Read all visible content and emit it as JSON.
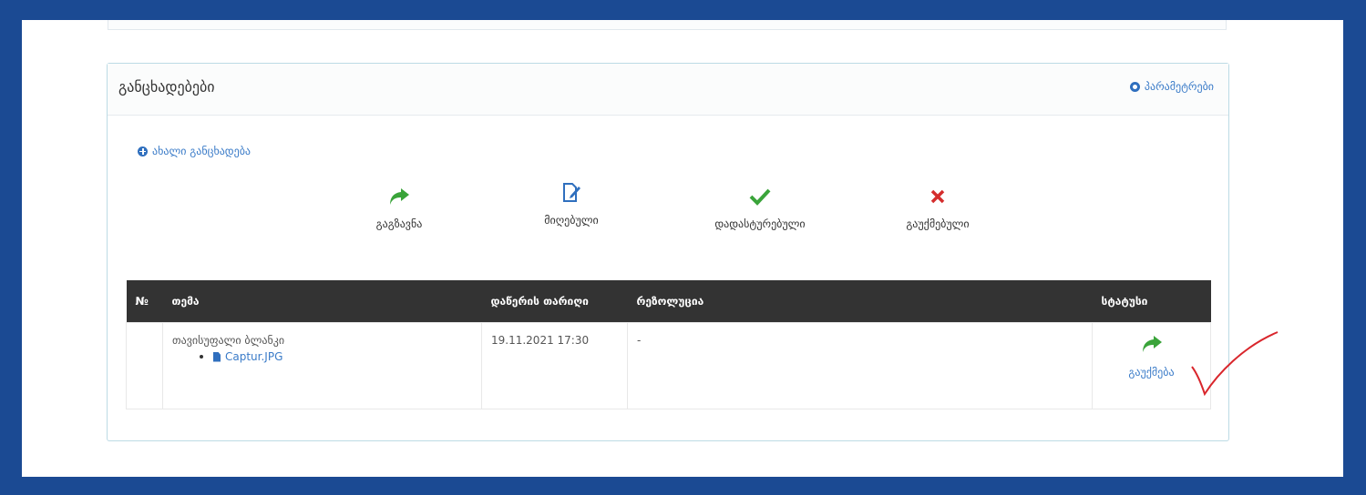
{
  "panel": {
    "title": "განცხადებები",
    "settings_label": "პარამეტრები",
    "new_label": "ახალი განცხადება"
  },
  "actions": [
    {
      "label": "გაგზავნა",
      "icon": "share-arrow-icon",
      "color": "#3aa43a"
    },
    {
      "label": "მიღებული",
      "icon": "edit-document-icon",
      "color": "#2f6fbe"
    },
    {
      "label": "დადასტურებული",
      "icon": "check-icon",
      "color": "#3aa43a"
    },
    {
      "label": "გაუქმებული",
      "icon": "x-icon",
      "color": "#d42d2d"
    }
  ],
  "table": {
    "headers": [
      "№",
      "თემა",
      "დაწერის თარიღი",
      "რეზოლუცია",
      "სტატუსი"
    ],
    "rows": [
      {
        "num": "",
        "topic": "თავისუფალი ბლანკი",
        "attachment": "Captur.JPG",
        "date": "19.11.2021 17:30",
        "resolution": "-",
        "status_label": "გაუქმება"
      }
    ]
  },
  "colors": {
    "frame_border": "#1b4a93",
    "header_dark": "#333333",
    "link_blue": "#3a7bc8",
    "accent_green": "#3aa43a",
    "annotation_red": "#d9262c"
  }
}
